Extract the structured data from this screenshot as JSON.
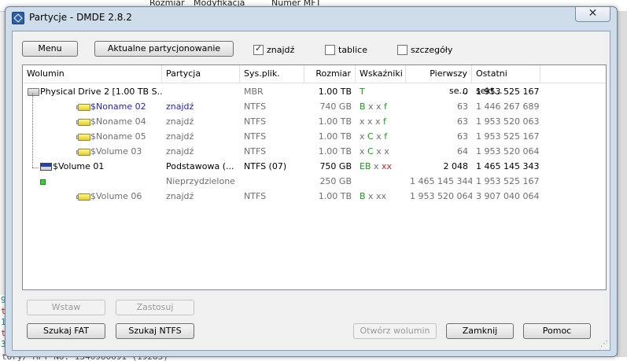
{
  "background": {
    "columns": [
      "Rozmiar",
      "Modyfikacja",
      "Numer MFT"
    ],
    "left_lines": [
      {
        "text": "9",
        "color": "#1a8a8a"
      },
      {
        "text": "tc",
        "color": "#cc2222"
      },
      {
        "text": "1",
        "color": "#1a8a8a"
      },
      {
        "text": "tc",
        "color": "#cc2222"
      },
      {
        "text": "3",
        "color": "#1a8a8a"
      }
    ],
    "bottom_text": "tory/ MFT No: 1346980691 (19283)"
  },
  "window": {
    "title": "Partycje - DMDE 2.8.2",
    "close_glyph": "✕"
  },
  "toolbar": {
    "menu_label": "Menu",
    "current_partitioning_label": "Aktualne partycjonowanie",
    "checkboxes": [
      {
        "label": "znajdź",
        "checked": true
      },
      {
        "label": "tablice",
        "checked": false
      },
      {
        "label": "szczegóły",
        "checked": false
      }
    ]
  },
  "list": {
    "columns": [
      "Wolumin",
      "Partycja",
      "Sys.plik.",
      "Rozmiar",
      "Wskaźniki",
      "Pierwszy se...",
      "Ostatni sekt..."
    ],
    "rows": [
      {
        "icon": "drive-icon",
        "name": "Physical Drive 2 [1.00 TB S...",
        "partition": "",
        "fs": "MBR",
        "size": "1.00 TB",
        "ind": [
          {
            "t": "T",
            "c": "green"
          }
        ],
        "first": "0",
        "last": "1 953 525 167",
        "name_color": "black",
        "part_color": "gray",
        "fs_color": "gray",
        "size_color": "black",
        "first_color": "black",
        "last_color": "black"
      },
      {
        "icon": "volume-icon",
        "name": "$Noname 02",
        "partition": "znajdź",
        "fs": "NTFS",
        "size": "740 GB",
        "ind": [
          {
            "t": "B",
            "c": "green"
          },
          {
            "t": " x x ",
            "c": "gray"
          },
          {
            "t": "f",
            "c": "green"
          }
        ],
        "first": "63",
        "last": "1 446 267 689",
        "name_color": "blue",
        "part_color": "blue",
        "fs_color": "gray",
        "size_color": "gray",
        "first_color": "gray",
        "last_color": "gray"
      },
      {
        "icon": "volume-icon",
        "name": "$Noname 04",
        "partition": "znajdź",
        "fs": "NTFS",
        "size": "1.00 TB",
        "ind": [
          {
            "t": "x x x ",
            "c": "gray"
          },
          {
            "t": "f",
            "c": "green"
          }
        ],
        "first": "63",
        "last": "1 953 520 063",
        "name_color": "gray",
        "part_color": "gray",
        "fs_color": "gray",
        "size_color": "gray",
        "first_color": "gray",
        "last_color": "gray"
      },
      {
        "icon": "volume-icon",
        "name": "$Noname 05",
        "partition": "znajdź",
        "fs": "NTFS",
        "size": "1.00 TB",
        "ind": [
          {
            "t": "x ",
            "c": "gray"
          },
          {
            "t": "C",
            "c": "green"
          },
          {
            "t": " x ",
            "c": "gray"
          },
          {
            "t": "f",
            "c": "green"
          }
        ],
        "first": "63",
        "last": "1 953 525 167",
        "name_color": "gray",
        "part_color": "gray",
        "fs_color": "gray",
        "size_color": "gray",
        "first_color": "gray",
        "last_color": "gray"
      },
      {
        "icon": "volume-icon",
        "name": "$Volume 03",
        "partition": "znajdź",
        "fs": "NTFS",
        "size": "1.00 TB",
        "ind": [
          {
            "t": "x ",
            "c": "gray"
          },
          {
            "t": "C",
            "c": "green"
          },
          {
            "t": " x x",
            "c": "gray"
          }
        ],
        "first": "64",
        "last": "1 953 520 064",
        "name_color": "gray",
        "part_color": "gray",
        "fs_color": "gray",
        "size_color": "gray",
        "first_color": "gray",
        "last_color": "gray"
      },
      {
        "icon": "flag-icon",
        "name": "$Volume 01",
        "partition": "Podstawowa (...",
        "fs": "NTFS (07)",
        "size": "750 GB",
        "ind": [
          {
            "t": "EB",
            "c": "green"
          },
          {
            "t": " x ",
            "c": "gray"
          },
          {
            "t": "xx",
            "c": "red"
          }
        ],
        "first": "2 048",
        "last": "1 465 145 343",
        "name_color": "black",
        "part_color": "black",
        "fs_color": "black",
        "size_color": "black",
        "first_color": "black",
        "last_color": "black"
      },
      {
        "icon": "free-icon",
        "name": "",
        "partition": "Nieprzydzielone",
        "fs": "",
        "size": "250 GB",
        "ind": [],
        "first": "1 465 145 344",
        "last": "1 953 525 167",
        "name_color": "gray",
        "part_color": "gray",
        "fs_color": "gray",
        "size_color": "gray",
        "first_color": "gray",
        "last_color": "gray"
      },
      {
        "icon": "volume-icon",
        "name": "$Volume 06",
        "partition": "znajdź",
        "fs": "NTFS",
        "size": "1.00 TB",
        "ind": [
          {
            "t": "B",
            "c": "green"
          },
          {
            "t": " x xx",
            "c": "gray"
          }
        ],
        "first": "1 953 520 064",
        "last": "3 907 040 064",
        "name_color": "gray",
        "part_color": "gray",
        "fs_color": "gray",
        "size_color": "gray",
        "first_color": "gray",
        "last_color": "gray"
      }
    ]
  },
  "buttons": {
    "insert_label": "Wstaw",
    "apply_label": "Zastosuj",
    "search_fat_label": "Szukaj FAT",
    "search_ntfs_label": "Szukaj NTFS",
    "open_volume_label": "Otwórz wolumin",
    "close_label": "Zamknij",
    "help_label": "Pomoc"
  }
}
